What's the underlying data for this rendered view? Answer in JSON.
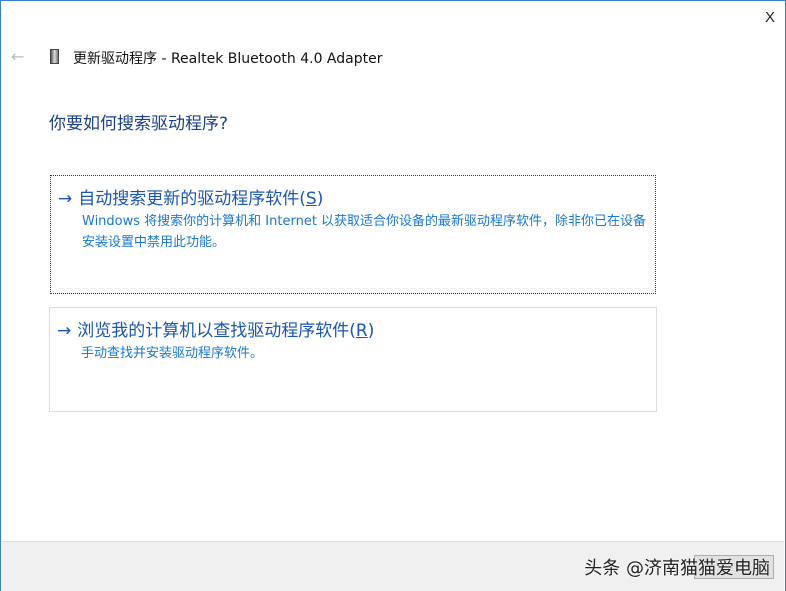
{
  "window": {
    "close_label": "X",
    "back_icon": "back-arrow-icon",
    "title": "更新驱动程序 - Realtek Bluetooth 4.0 Adapter"
  },
  "heading": "你要如何搜索驱动程序?",
  "options": [
    {
      "arrow": "→",
      "label": "自动搜索更新的驱动程序软件(",
      "accel": "S",
      "close": ")",
      "description": "Windows 将搜索你的计算机和 Internet 以获取适合你设备的最新驱动程序软件，除非你已在设备安装设置中禁用此功能。"
    },
    {
      "arrow": "→",
      "label": "浏览我的计算机以查找驱动程序软件(",
      "accel": "R",
      "close": ")",
      "description": "手动查找并安装驱动程序软件。"
    }
  ],
  "watermark": "头条 @济南猫猫爱电脑",
  "colors": {
    "accent": "#1a56b8",
    "desc": "#1a78d6",
    "border": "#3a7fc8"
  }
}
